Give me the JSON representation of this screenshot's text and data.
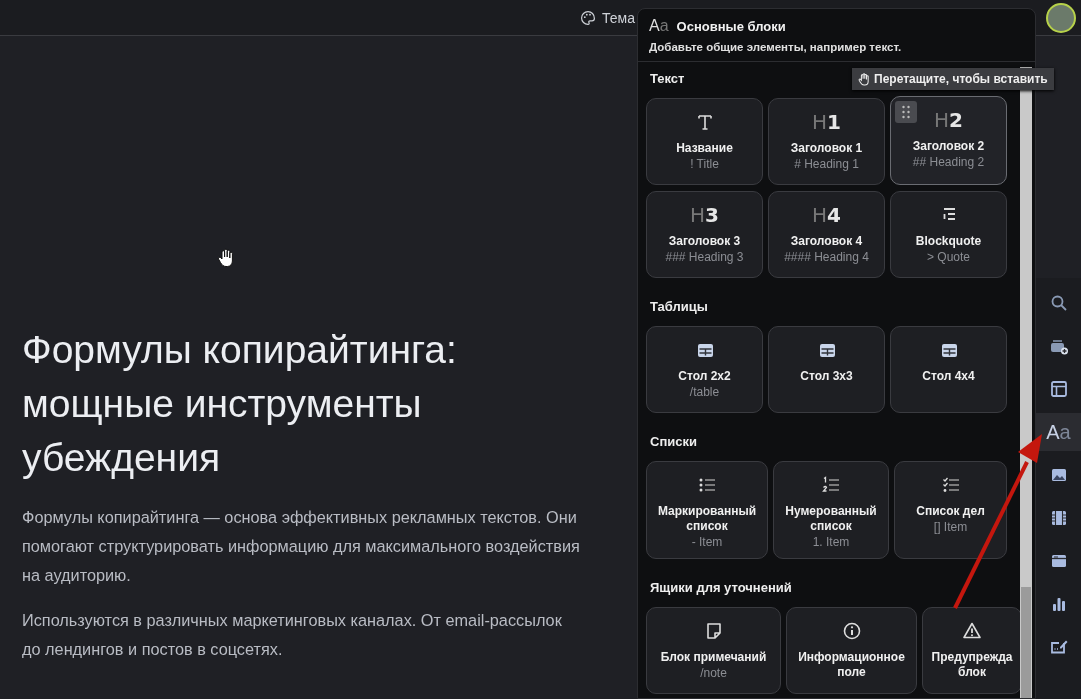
{
  "top_bar": {
    "theme_label": "Тема"
  },
  "article": {
    "title": "Формулы копирайтинга: мощные инструменты убеждения",
    "paragraphs": [
      "Формулы копирайтинга — основа эффективных рекламных текстов. Они помогают структурировать информацию для максимального воздействия на аудиторию.",
      "Используются в различных маркетинговых каналах. От email-рассылок до лендингов и постов в соцсетях."
    ]
  },
  "panel": {
    "glyph": [
      "A",
      "a"
    ],
    "title": "Основные блоки",
    "subtitle": "Добавьте общие элементы, например текст.",
    "tooltip": "Перетащите, чтобы вставить",
    "sections": [
      {
        "title": "Текст",
        "blocks": [
          {
            "kind": "text",
            "label": "Название",
            "hint": "! Title",
            "hovered": false
          },
          {
            "kind": "glyph",
            "glyph": [
              "H",
              "1"
            ],
            "label": "Заголовок 1",
            "hint": "# Heading 1",
            "hovered": false
          },
          {
            "kind": "glyph",
            "glyph": [
              "H",
              "2"
            ],
            "label": "Заголовок 2",
            "hint": "## Heading 2",
            "hovered": true
          },
          {
            "kind": "glyph",
            "glyph": [
              "H",
              "3"
            ],
            "label": "Заголовок 3",
            "hint": "### Heading 3",
            "hovered": false
          },
          {
            "kind": "glyph",
            "glyph": [
              "H",
              "4"
            ],
            "label": "Заголовок 4",
            "hint": "#### Heading 4",
            "hovered": false
          },
          {
            "kind": "quote",
            "label": "Blockquote",
            "hint": "> Quote",
            "hovered": false
          }
        ]
      },
      {
        "title": "Таблицы",
        "blocks": [
          {
            "kind": "table",
            "label": "Стол 2x2",
            "hint": "/table",
            "hovered": false
          },
          {
            "kind": "table",
            "label": "Стол 3x3",
            "hovered": false
          },
          {
            "kind": "table",
            "label": "Стол 4x4",
            "hovered": false
          }
        ]
      },
      {
        "title": "Списки",
        "blocks": [
          {
            "kind": "bullets",
            "label": "Маркированный список",
            "hint": "- Item",
            "hovered": false
          },
          {
            "kind": "numbers",
            "label": "Нумерованный список",
            "hint": "1. Item",
            "hovered": false
          },
          {
            "kind": "checks",
            "label": "Список дел",
            "hint": "[] Item",
            "hovered": false
          }
        ]
      },
      {
        "title": "Ящики для уточнений",
        "blocks": [
          {
            "kind": "note",
            "label": "Блок примечаний",
            "hint": "/note",
            "hovered": false
          },
          {
            "kind": "info",
            "label": "Информационное поле",
            "hovered": false
          },
          {
            "kind": "warning",
            "label": "Предупрежда блок",
            "hovered": false
          }
        ]
      }
    ]
  },
  "tool_rail": [
    {
      "kind": "search",
      "selected": false
    },
    {
      "kind": "stack-add",
      "selected": false
    },
    {
      "kind": "layout",
      "selected": false
    },
    {
      "kind": "glyph",
      "glyph": [
        "A",
        "a"
      ],
      "selected": true
    },
    {
      "kind": "image",
      "selected": false
    },
    {
      "kind": "film",
      "selected": false
    },
    {
      "kind": "card",
      "selected": false
    },
    {
      "kind": "chart",
      "selected": false
    },
    {
      "kind": "edit",
      "selected": false
    }
  ]
}
